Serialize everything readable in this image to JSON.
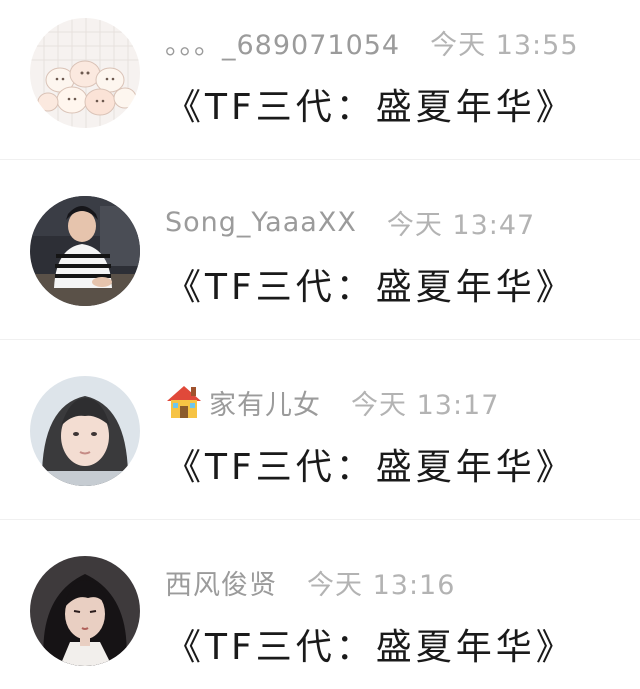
{
  "comments": [
    {
      "username": "。。。_689071054",
      "time": "今天 13:55",
      "text": "《TF三代：盛夏年华》",
      "avatar_icon": "cartoon-animals-avatar"
    },
    {
      "username": "Song_YaaaXX",
      "time": "今天 13:47",
      "text": "《TF三代：盛夏年华》",
      "avatar_icon": "person-striped-sweater-avatar"
    },
    {
      "username": "家有儿女",
      "username_icon": "house-emoji-icon",
      "time": "今天 13:17",
      "text": "《TF三代：盛夏年华》",
      "avatar_icon": "child-portrait-avatar"
    },
    {
      "username": "西风俊贤",
      "time": "今天 13:16",
      "text": "《TF三代：盛夏年华》",
      "avatar_icon": "anime-character-avatar"
    }
  ]
}
